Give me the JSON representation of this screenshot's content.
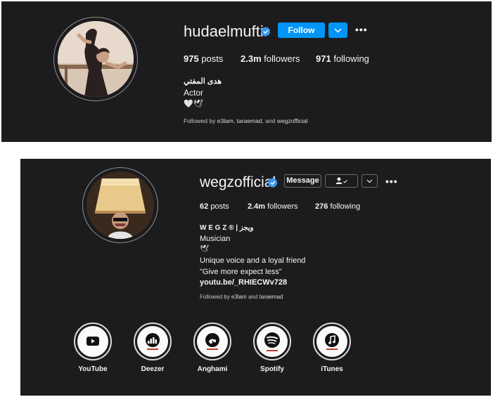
{
  "profile1": {
    "username": "hudaelmufti",
    "follow_label": "Follow",
    "more_label": "•••",
    "posts_count": "975",
    "posts_label": "posts",
    "followers_count": "2.3m",
    "followers_label": "followers",
    "following_count": "971",
    "following_label": "following",
    "display_name": "هدى المفتي",
    "category": "Actor",
    "emojis": "🤍🕊",
    "followed_by_prefix": "Followed by",
    "followed_by_1": "e3lam",
    "followed_by_2": "taraemad",
    "followed_by_sep": ", ",
    "followed_by_and": ", and",
    "followed_by_3": "wegzofficial"
  },
  "profile2": {
    "username": "wegzofficial",
    "message_label": "Message",
    "more_label": "•••",
    "posts_count": "62",
    "posts_label": "posts",
    "followers_count": "2.4m",
    "followers_label": "followers",
    "following_count": "276",
    "following_label": "following",
    "display_name": "W E G Z ® | ويجز",
    "category": "Musician",
    "emoji": "🕊",
    "bio_1": "Unique voice and a loyal friend",
    "bio_2": "\"Give more expect less\"",
    "link": "youtu.be/_RHIECWv728",
    "followed_by_prefix": "Followed by",
    "followed_by_1": "e3lam",
    "followed_by_and": "and",
    "followed_by_2": "taraemad",
    "highlights": [
      {
        "label": "YouTube",
        "icon": "youtube-icon"
      },
      {
        "label": "Deezer",
        "icon": "deezer-icon"
      },
      {
        "label": "Anghami",
        "icon": "anghami-icon"
      },
      {
        "label": "Spotify",
        "icon": "spotify-icon"
      },
      {
        "label": "iTunes",
        "icon": "itunes-icon"
      }
    ]
  },
  "colors": {
    "card_bg": "#1c1c1e",
    "accent_blue": "#0095f6",
    "verified_blue": "#3897f0"
  }
}
